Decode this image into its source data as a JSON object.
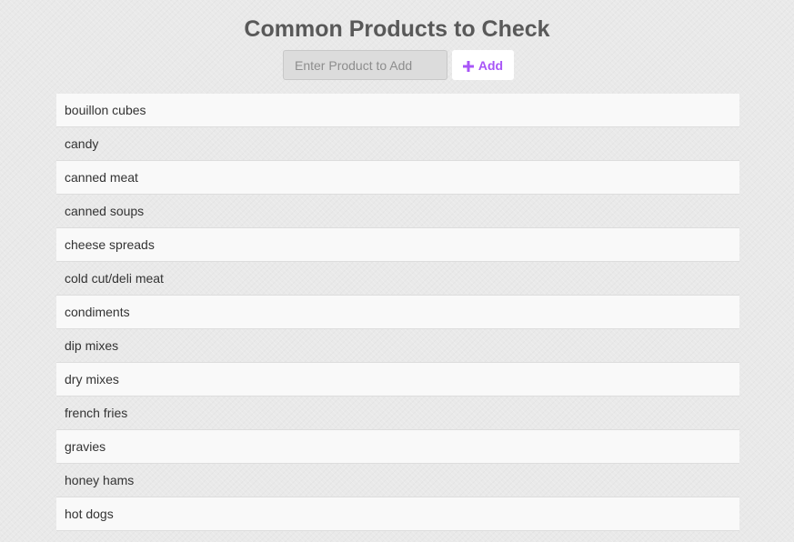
{
  "page": {
    "title": "Common Products to Check"
  },
  "form": {
    "input_placeholder": "Enter Product to Add",
    "input_value": "",
    "add_label": "Add",
    "add_icon": "plus-icon",
    "accent_color": "#a855f7"
  },
  "products": [
    {
      "label": "bouillon cubes"
    },
    {
      "label": "candy"
    },
    {
      "label": "canned meat"
    },
    {
      "label": "canned soups"
    },
    {
      "label": "cheese spreads"
    },
    {
      "label": "cold cut/deli meat"
    },
    {
      "label": "condiments"
    },
    {
      "label": "dip mixes"
    },
    {
      "label": "dry mixes"
    },
    {
      "label": "french fries"
    },
    {
      "label": "gravies"
    },
    {
      "label": "honey hams"
    },
    {
      "label": "hot dogs"
    }
  ]
}
